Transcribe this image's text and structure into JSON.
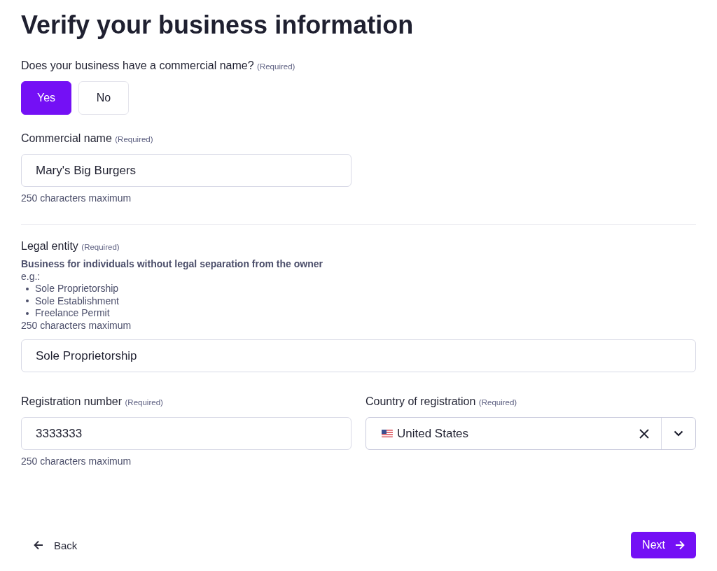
{
  "title": "Verify your business information",
  "question": {
    "label": "Does your business have a commercial name?",
    "required": "(Required)",
    "options": [
      {
        "label": "Yes",
        "selected": true
      },
      {
        "label": "No",
        "selected": false
      }
    ]
  },
  "commercial_name": {
    "label": "Commercial name",
    "required": "(Required)",
    "value": "Mary's Big Burgers",
    "hint": "250 characters maximum"
  },
  "legal_entity": {
    "label": "Legal entity",
    "required": "(Required)",
    "description": "Business for individuals without legal separation from the owner",
    "example_label": "e.g.:",
    "examples": [
      "Sole Proprietorship",
      "Sole Establishment",
      "Freelance Permit"
    ],
    "hint": "250 characters maximum",
    "value": "Sole Proprietorship"
  },
  "registration_number": {
    "label": "Registration number",
    "required": "(Required)",
    "value": "3333333",
    "hint": "250 characters maximum"
  },
  "country": {
    "label": "Country of registration",
    "required": "(Required)",
    "value": "United States"
  },
  "back": "Back",
  "next": "Next"
}
